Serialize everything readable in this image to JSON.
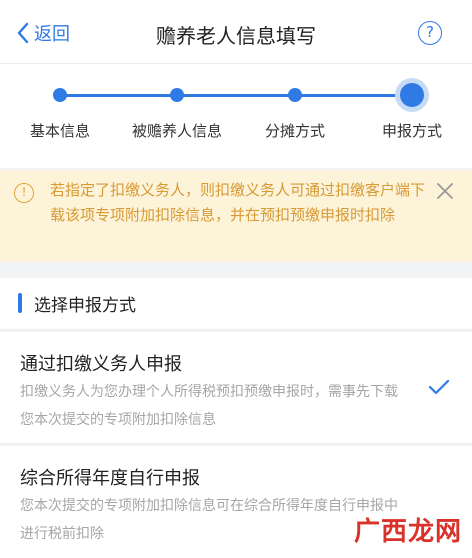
{
  "header": {
    "back_label": "返回",
    "title": "赡养老人信息填写",
    "help_symbol": "?"
  },
  "steps": [
    {
      "label": "基本信息",
      "done": true
    },
    {
      "label": "被赡养人信息",
      "done": true
    },
    {
      "label": "分摊方式",
      "done": true
    },
    {
      "label": "申报方式",
      "active": true
    }
  ],
  "notice": {
    "icon_symbol": "!",
    "text": "若指定了扣缴义务人，则扣缴义务人可通过扣缴客户端下载该项专项附加扣除信息，并在预扣预缴申报时扣除"
  },
  "section": {
    "title": "选择申报方式"
  },
  "options": [
    {
      "title": "通过扣缴义务人申报",
      "description": "扣缴义务人为您办理个人所得税预扣预缴申报时，需事先下载您本次提交的专项附加扣除信息",
      "selected": true
    },
    {
      "title": "综合所得年度自行申报",
      "description": "您本次提交的专项附加扣除信息可在综合所得年度自行申报中进行税前扣除",
      "selected": false
    }
  ],
  "watermark": "广西龙网",
  "colors": {
    "accent": "#2f7ae5",
    "notice_bg": "#fdf3d8",
    "notice_text": "#d79a35"
  }
}
